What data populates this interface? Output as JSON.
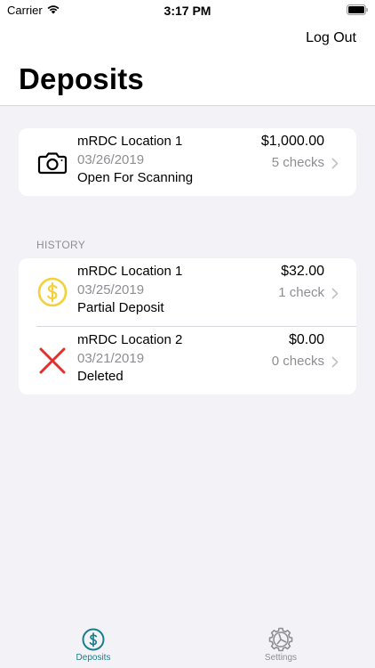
{
  "status_bar": {
    "carrier": "Carrier",
    "time": "3:17 PM"
  },
  "nav": {
    "logout_label": "Log Out",
    "title": "Deposits"
  },
  "current": {
    "icon": "camera-icon",
    "name": "mRDC Location 1",
    "date": "03/26/2019",
    "status": "Open For Scanning",
    "amount": "$1,000.00",
    "count": "5 checks"
  },
  "history": {
    "header": "HISTORY",
    "items": [
      {
        "icon": "dollar-coin-icon",
        "name": "mRDC Location 1",
        "date": "03/25/2019",
        "status": "Partial Deposit",
        "amount": "$32.00",
        "count": "1 check"
      },
      {
        "icon": "red-x-icon",
        "name": "mRDC Location 2",
        "date": "03/21/2019",
        "status": "Deleted",
        "amount": "$0.00",
        "count": "0 checks"
      }
    ]
  },
  "tabs": [
    {
      "label": "Deposits",
      "icon": "dollar-circle-icon",
      "selected": true
    },
    {
      "label": "Settings",
      "icon": "gear-icon",
      "selected": false
    }
  ],
  "colors": {
    "accent": "#1b7f8a",
    "coin": "#f2d13a",
    "delete": "#e0312e",
    "secondary": "#8e8e93"
  }
}
